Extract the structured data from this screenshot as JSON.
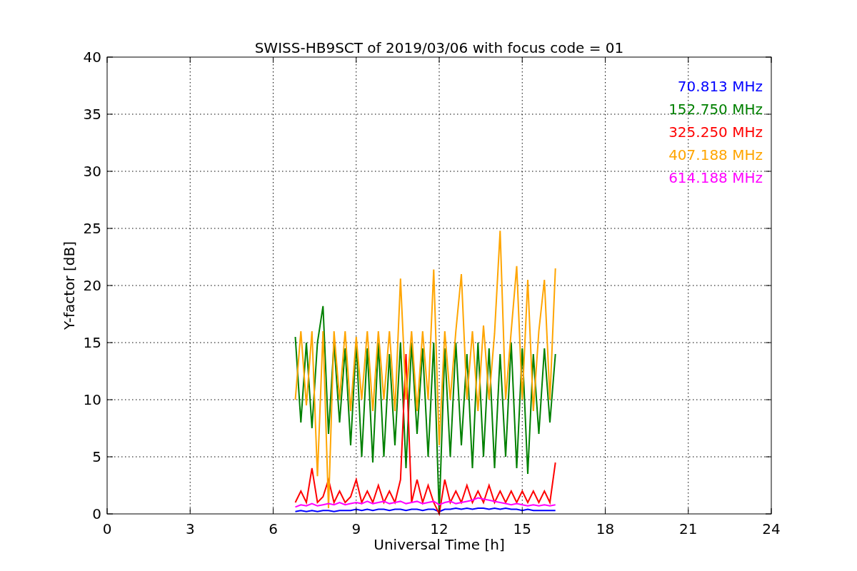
{
  "figure": {
    "chart_data": {
      "type": "line",
      "title": "SWISS-HB9SCT of 2019/03/06 with focus code = 01",
      "xlabel": "Universal Time [h]",
      "ylabel": "Y-factor [dB]",
      "xlim": [
        0,
        24
      ],
      "ylim": [
        0,
        40
      ],
      "xticks": [
        0,
        3,
        6,
        9,
        12,
        15,
        18,
        21,
        24
      ],
      "yticks": [
        0,
        5,
        10,
        15,
        20,
        25,
        30,
        35,
        40
      ],
      "grid": true,
      "x": [
        6.8,
        7.0,
        7.2,
        7.4,
        7.6,
        7.8,
        8.0,
        8.2,
        8.4,
        8.6,
        8.8,
        9.0,
        9.2,
        9.4,
        9.6,
        9.8,
        10.0,
        10.2,
        10.4,
        10.6,
        10.8,
        11.0,
        11.2,
        11.4,
        11.6,
        11.8,
        12.0,
        12.2,
        12.4,
        12.6,
        12.8,
        13.0,
        13.2,
        13.4,
        13.6,
        13.8,
        14.0,
        14.2,
        14.4,
        14.6,
        14.8,
        15.0,
        15.2,
        15.4,
        15.6,
        15.8,
        16.0,
        16.2
      ],
      "series": [
        {
          "name": "70.813 MHz",
          "color": "#0000ff",
          "values": [
            0.2,
            0.3,
            0.2,
            0.3,
            0.2,
            0.3,
            0.3,
            0.2,
            0.3,
            0.3,
            0.3,
            0.4,
            0.3,
            0.4,
            0.3,
            0.4,
            0.4,
            0.3,
            0.4,
            0.4,
            0.3,
            0.4,
            0.4,
            0.3,
            0.4,
            0.4,
            0.2,
            0.4,
            0.4,
            0.5,
            0.4,
            0.5,
            0.4,
            0.5,
            0.5,
            0.4,
            0.5,
            0.4,
            0.5,
            0.4,
            0.4,
            0.3,
            0.4,
            0.3,
            0.3,
            0.3,
            0.3,
            0.3
          ]
        },
        {
          "name": "152.750 MHz",
          "color": "#008000",
          "values": [
            15.5,
            8,
            15,
            7.5,
            15,
            18.2,
            7,
            15,
            8,
            14.5,
            6,
            15,
            5,
            14.5,
            4.5,
            15,
            5,
            14,
            6,
            15,
            4,
            15,
            7,
            14.5,
            5,
            15,
            0,
            14.5,
            5,
            15,
            6,
            14,
            4,
            15,
            5,
            14.5,
            4,
            14,
            5,
            15,
            4,
            14.5,
            3.5,
            14,
            7,
            14.5,
            8,
            14
          ]
        },
        {
          "name": "325.250 MHz",
          "color": "#ff0000",
          "values": [
            1,
            2,
            1,
            4,
            1,
            1.5,
            3,
            1,
            2,
            1,
            1.5,
            3,
            1,
            2,
            1,
            2.5,
            1,
            2,
            1,
            3,
            14,
            1,
            3,
            1,
            2.5,
            1,
            0,
            3,
            1,
            2,
            1,
            2.5,
            1,
            2,
            1,
            2.5,
            1,
            2,
            1,
            2,
            1,
            2,
            1,
            2,
            1,
            2,
            1,
            4.5
          ]
        },
        {
          "name": "407.188 MHz",
          "color": "#ffa500",
          "values": [
            10,
            16,
            9.5,
            16,
            3.3,
            16,
            0.5,
            16,
            10,
            16,
            9,
            15.5,
            10,
            16,
            9,
            16,
            10,
            16,
            9,
            20.6,
            10,
            16,
            9,
            16,
            10,
            21.4,
            6,
            16,
            10,
            16,
            21,
            10,
            16,
            9,
            16.5,
            10,
            15.8,
            24.8,
            10,
            16,
            21.7,
            10,
            20.5,
            9,
            16,
            20.5,
            10,
            21.5
          ]
        },
        {
          "name": "614.188 MHz",
          "color": "#ff00ff",
          "values": [
            0.6,
            0.8,
            0.7,
            0.9,
            0.7,
            0.8,
            0.9,
            0.8,
            1.0,
            0.8,
            0.9,
            1.0,
            0.9,
            1.1,
            0.9,
            1.0,
            1.1,
            0.9,
            1.0,
            1.1,
            0.9,
            1.0,
            1.1,
            0.9,
            1.0,
            1.1,
            0.8,
            1.0,
            1.1,
            0.9,
            1.0,
            1.1,
            1.2,
            1.4,
            1.3,
            1.2,
            1.1,
            1.0,
            0.9,
            0.8,
            0.9,
            0.8,
            0.7,
            0.8,
            0.7,
            0.8,
            0.7,
            0.8
          ]
        }
      ]
    }
  }
}
